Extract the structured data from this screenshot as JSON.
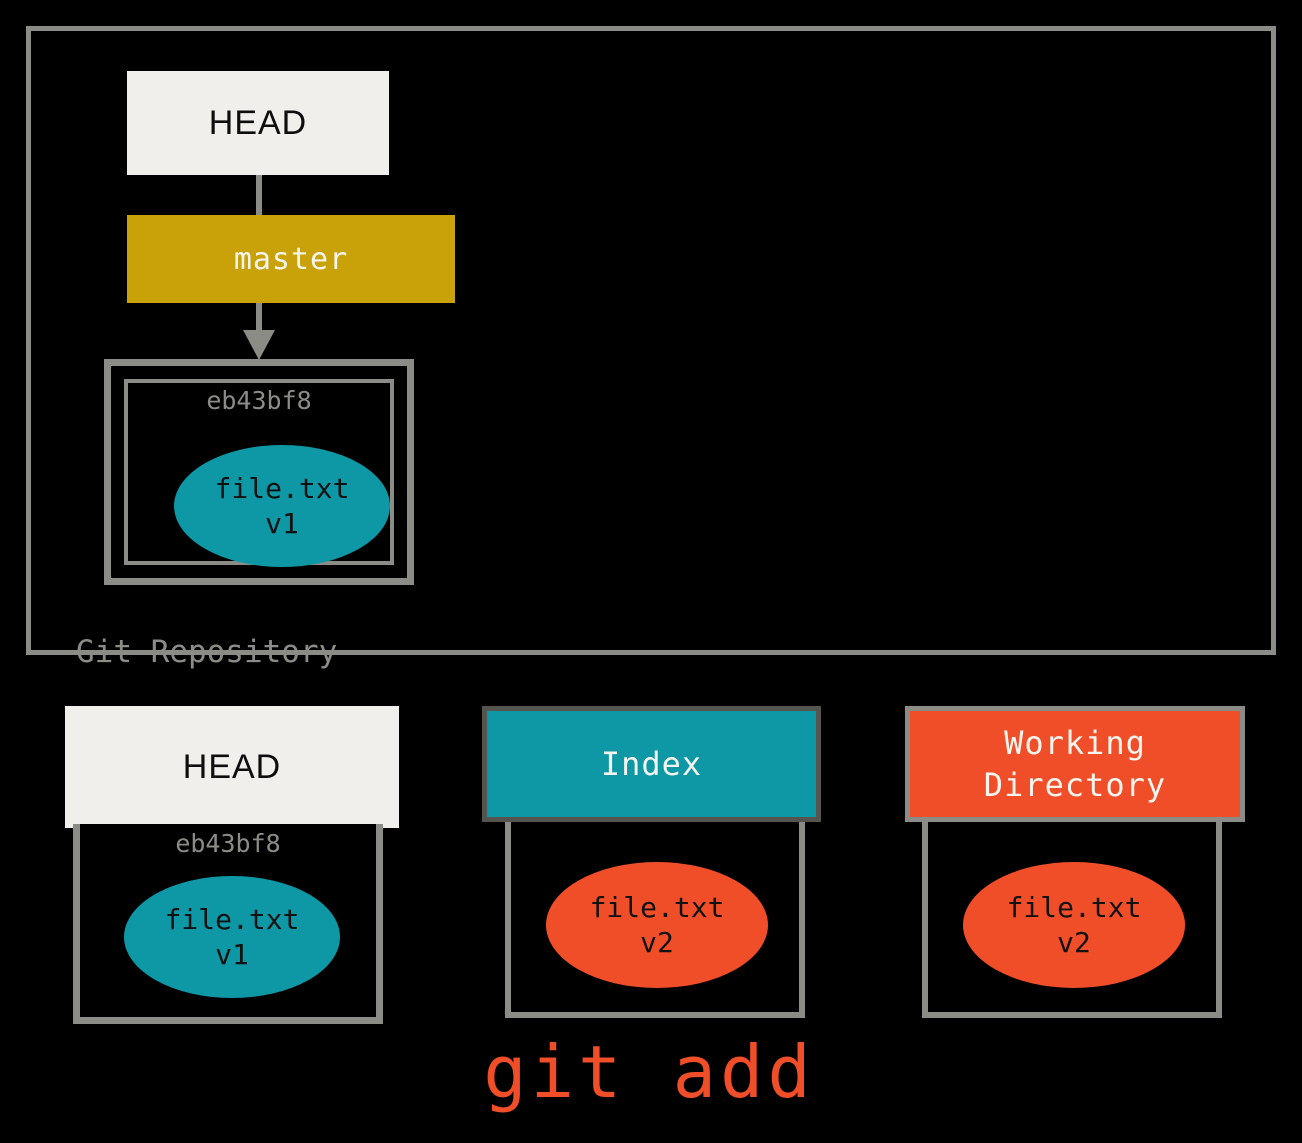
{
  "diagram": {
    "title_caption": "git add",
    "colors": {
      "background": "#000000",
      "border_gray": "#8c8c87",
      "head_box": "#f0efec",
      "branch_gold": "#c9a20a",
      "index_teal": "#0e97a4",
      "working_red": "#f04e28",
      "text_light": "#f5f5f0",
      "text_dark": "#0d0d0d"
    }
  },
  "repository": {
    "label": "Git Repository",
    "head_ref": {
      "label": "HEAD"
    },
    "branch": {
      "label": "master"
    },
    "commit": {
      "hash": "eb43bf8",
      "blob": {
        "filename": "file.txt",
        "version": "v1"
      }
    }
  },
  "panels": [
    {
      "name": "head",
      "header_label": "HEAD",
      "hash": "eb43bf8",
      "blob": {
        "filename": "file.txt",
        "version": "v1"
      }
    },
    {
      "name": "index",
      "header_label": "Index",
      "blob": {
        "filename": "file.txt",
        "version": "v2"
      }
    },
    {
      "name": "working-directory",
      "header_label_line1": "Working",
      "header_label_line2": "Directory",
      "blob": {
        "filename": "file.txt",
        "version": "v2"
      }
    }
  ]
}
